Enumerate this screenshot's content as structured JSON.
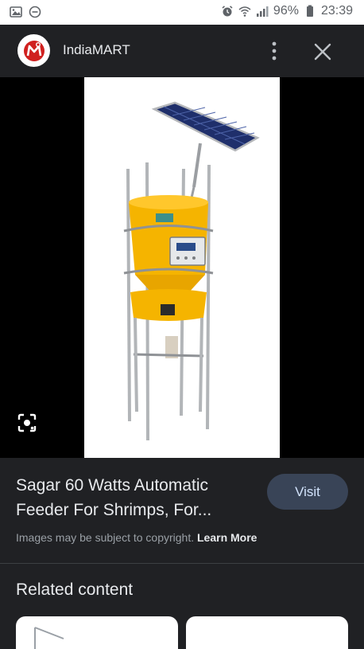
{
  "status_bar": {
    "battery": "96%",
    "time": "23:39",
    "icons": [
      "image-icon",
      "do-not-disturb-icon",
      "alarm-icon",
      "wifi-icon",
      "signal-icon",
      "battery-icon"
    ]
  },
  "header": {
    "source_name": "IndiaMART",
    "logo_icon": "indiamart-logo-icon",
    "brand_color": "#d0201f"
  },
  "product": {
    "title": "Sagar 60 Watts Automatic Feeder For Shrimps, For...",
    "visit_label": "Visit",
    "copyright_text": "Images may be subject to copyright.",
    "learn_more_label": "Learn More"
  },
  "related": {
    "heading": "Related content"
  },
  "colors": {
    "background": "#202124",
    "visit_button": "#394457",
    "feeder_yellow": "#f5b400"
  }
}
